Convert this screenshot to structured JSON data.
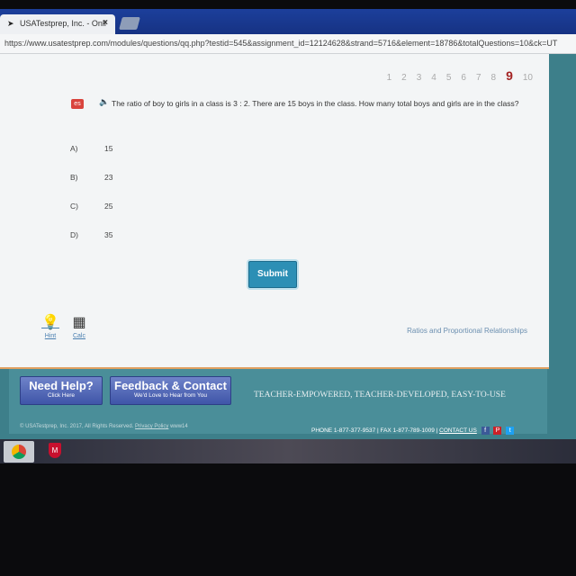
{
  "browser": {
    "tab_title": "USATestprep, Inc. - Onli",
    "url": "https://www.usatestprep.com/modules/questions/qq.php?testid=545&assignment_id=12124628&strand=5716&element=18786&totalQuestions=10&ck=UT"
  },
  "question_nav": {
    "numbers": [
      "1",
      "2",
      "3",
      "4",
      "5",
      "6",
      "7",
      "8",
      "9",
      "10"
    ],
    "current": "9"
  },
  "question": {
    "lang_badge": "es",
    "speaker_icon": "speaker-icon",
    "text": "The ratio of boy to girls in a class is 3 : 2. There are 15 boys in the class. How many total boys and girls are in the class?",
    "choices": [
      {
        "letter": "A)",
        "value": "15"
      },
      {
        "letter": "B)",
        "value": "23"
      },
      {
        "letter": "C)",
        "value": "25"
      },
      {
        "letter": "D)",
        "value": "35"
      }
    ]
  },
  "submit_label": "Submit",
  "tools": {
    "hint": "Hint",
    "calc": "Calc"
  },
  "strand": "Ratios and Proportional Relationships",
  "footer": {
    "help_big": "Need Help?",
    "help_small": "Click Here",
    "feedback_big": "Feedback & Contact",
    "feedback_small": "We'd Love to Hear from You",
    "tagline": "TEACHER-EMPOWERED, TEACHER-DEVELOPED, EASY-TO-USE",
    "copyright": "© USATestprep, Inc. 2017, All Rights Reserved.",
    "privacy": "Privacy Policy",
    "server": "www14",
    "contact": "PHONE 1-877-377-9537 | FAX 1-877-789-1009 |",
    "contact_link": "CONTACT US"
  },
  "colors": {
    "accent": "#2c8fb5",
    "current_question": "#a32222",
    "footer": "#4a8e99"
  }
}
